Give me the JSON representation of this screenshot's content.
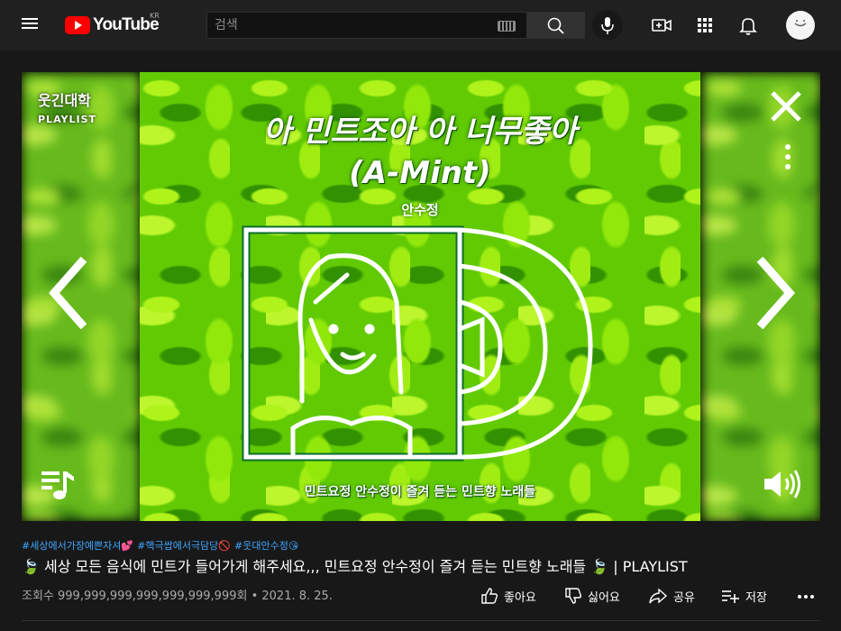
{
  "header": {
    "logo_text": "YouTube",
    "region": "KR",
    "search_placeholder": "검색"
  },
  "player": {
    "channel_logo_ko": "웃긴대학",
    "channel_logo_en": "PLAYLIST",
    "art_title_line1": "아 민트조아 아 너무좋아",
    "art_title_line2": "(A-Mint)",
    "art_artist": "안수정",
    "art_caption": "민트요정 안수정이 즐겨 듣는 민트향 노래들"
  },
  "video": {
    "hashtags": [
      "#세상에서가장예쁜자셔💕",
      "#핵극쌉에서극담당🚫",
      "#웃대안수정😘"
    ],
    "title": "🍃 세상 모든 음식에 민트가 들어가게 해주세요,,, 민트요정 안수정이 즐겨 듣는 민트향 노래들 🍃 | PLAYLIST",
    "views": "조회수 999,999,999,999,999,999,999회 • 2021. 8. 25.",
    "actions": {
      "like": "좋아요",
      "dislike": "싫어요",
      "share": "공유",
      "save": "저장"
    }
  },
  "colors": {
    "background": "#181818",
    "header": "#202020",
    "accent_red": "#ff0000",
    "hashtag_blue": "#3ea6ff",
    "mint_green": "#6cc41e"
  }
}
